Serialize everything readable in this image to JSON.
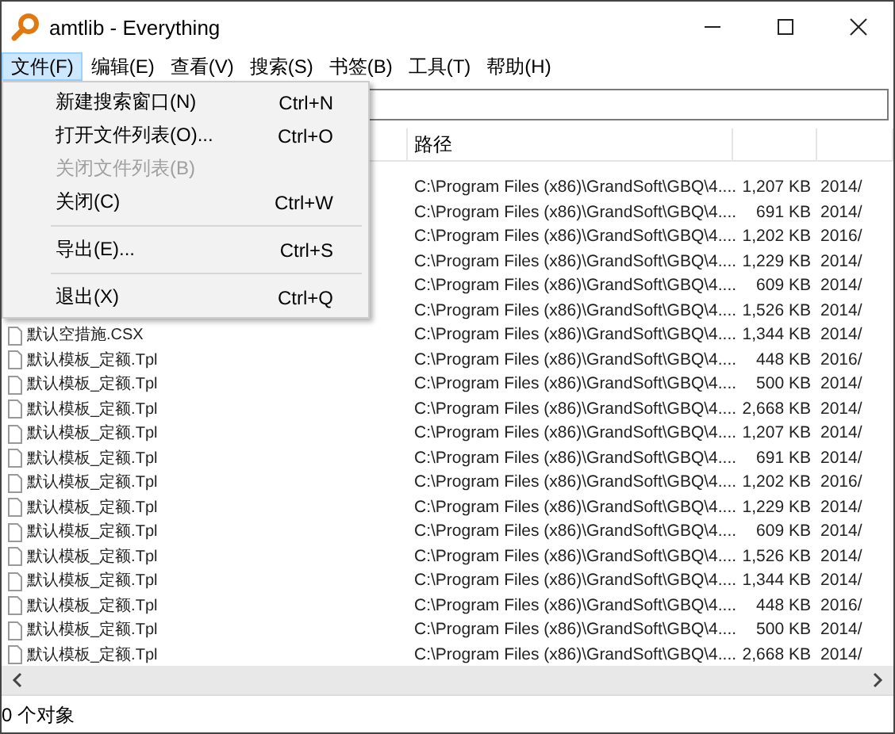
{
  "window": {
    "title": "amtlib - Everything"
  },
  "menubar": [
    {
      "label": "文件(F)",
      "selected": true
    },
    {
      "label": "编辑(E)",
      "selected": false
    },
    {
      "label": "查看(V)",
      "selected": false
    },
    {
      "label": "搜索(S)",
      "selected": false
    },
    {
      "label": "书签(B)",
      "selected": false
    },
    {
      "label": "工具(T)",
      "selected": false
    },
    {
      "label": "帮助(H)",
      "selected": false
    }
  ],
  "file_menu": [
    {
      "kind": "item",
      "label": "新建搜索窗口(N)",
      "shortcut": "Ctrl+N",
      "disabled": false
    },
    {
      "kind": "item",
      "label": "打开文件列表(O)...",
      "shortcut": "Ctrl+O",
      "disabled": false
    },
    {
      "kind": "item",
      "label": "关闭文件列表(B)",
      "disabled": true
    },
    {
      "kind": "item",
      "label": "关闭(C)",
      "shortcut": "Ctrl+W",
      "disabled": false
    },
    {
      "kind": "separator"
    },
    {
      "kind": "item",
      "label": "导出(E)...",
      "shortcut": "Ctrl+S",
      "disabled": false
    },
    {
      "kind": "separator"
    },
    {
      "kind": "item",
      "label": "退出(X)",
      "shortcut": "Ctrl+Q",
      "disabled": false
    }
  ],
  "table": {
    "columns": [
      "路径"
    ],
    "rows": [
      {
        "path": "C:\\Program Files (x86)\\GrandSoft\\GBQ\\4....",
        "size": "1,207 KB",
        "date": "2014/"
      },
      {
        "path": "C:\\Program Files (x86)\\GrandSoft\\GBQ\\4....",
        "size": "691 KB",
        "date": "2014/"
      },
      {
        "path": "C:\\Program Files (x86)\\GrandSoft\\GBQ\\4....",
        "size": "1,202 KB",
        "date": "2016/"
      },
      {
        "path": "C:\\Program Files (x86)\\GrandSoft\\GBQ\\4....",
        "size": "1,229 KB",
        "date": "2014/"
      },
      {
        "path": "C:\\Program Files (x86)\\GrandSoft\\GBQ\\4....",
        "size": "609 KB",
        "date": "2014/"
      },
      {
        "path": "C:\\Program Files (x86)\\GrandSoft\\GBQ\\4....",
        "size": "1,526 KB",
        "date": "2014/"
      },
      {
        "name": "默认空措施.CSX",
        "path": "C:\\Program Files (x86)\\GrandSoft\\GBQ\\4....",
        "size": "1,344 KB",
        "date": "2014/"
      },
      {
        "name": "默认模板_定额.Tpl",
        "path": "C:\\Program Files (x86)\\GrandSoft\\GBQ\\4....",
        "size": "448 KB",
        "date": "2016/"
      },
      {
        "name": "默认模板_定额.Tpl",
        "path": "C:\\Program Files (x86)\\GrandSoft\\GBQ\\4....",
        "size": "500 KB",
        "date": "2014/"
      },
      {
        "name": "默认模板_定额.Tpl",
        "path": "C:\\Program Files (x86)\\GrandSoft\\GBQ\\4....",
        "size": "2,668 KB",
        "date": "2014/"
      },
      {
        "name": "默认模板_定额.Tpl",
        "path": "C:\\Program Files (x86)\\GrandSoft\\GBQ\\4....",
        "size": "1,207 KB",
        "date": "2014/"
      },
      {
        "name": "默认模板_定额.Tpl",
        "path": "C:\\Program Files (x86)\\GrandSoft\\GBQ\\4....",
        "size": "691 KB",
        "date": "2014/"
      },
      {
        "name": "默认模板_定额.Tpl",
        "path": "C:\\Program Files (x86)\\GrandSoft\\GBQ\\4....",
        "size": "1,202 KB",
        "date": "2016/"
      },
      {
        "name": "默认模板_定额.Tpl",
        "path": "C:\\Program Files (x86)\\GrandSoft\\GBQ\\4....",
        "size": "1,229 KB",
        "date": "2014/"
      },
      {
        "name": "默认模板_定额.Tpl",
        "path": "C:\\Program Files (x86)\\GrandSoft\\GBQ\\4....",
        "size": "609 KB",
        "date": "2014/"
      },
      {
        "name": "默认模板_定额.Tpl",
        "path": "C:\\Program Files (x86)\\GrandSoft\\GBQ\\4....",
        "size": "1,526 KB",
        "date": "2014/"
      },
      {
        "name": "默认模板_定额.Tpl",
        "path": "C:\\Program Files (x86)\\GrandSoft\\GBQ\\4....",
        "size": "1,344 KB",
        "date": "2014/"
      },
      {
        "name": "默认模板_定额.Tpl",
        "path": "C:\\Program Files (x86)\\GrandSoft\\GBQ\\4....",
        "size": "448 KB",
        "date": "2016/"
      },
      {
        "name": "默认模板_定额.Tpl",
        "path": "C:\\Program Files (x86)\\GrandSoft\\GBQ\\4....",
        "size": "500 KB",
        "date": "2014/"
      },
      {
        "name": "默认模板_定额.Tpl",
        "path": "C:\\Program Files (x86)\\GrandSoft\\GBQ\\4....",
        "size": "2,668 KB",
        "date": "2014/"
      }
    ]
  },
  "status_bar": "0 个对象"
}
